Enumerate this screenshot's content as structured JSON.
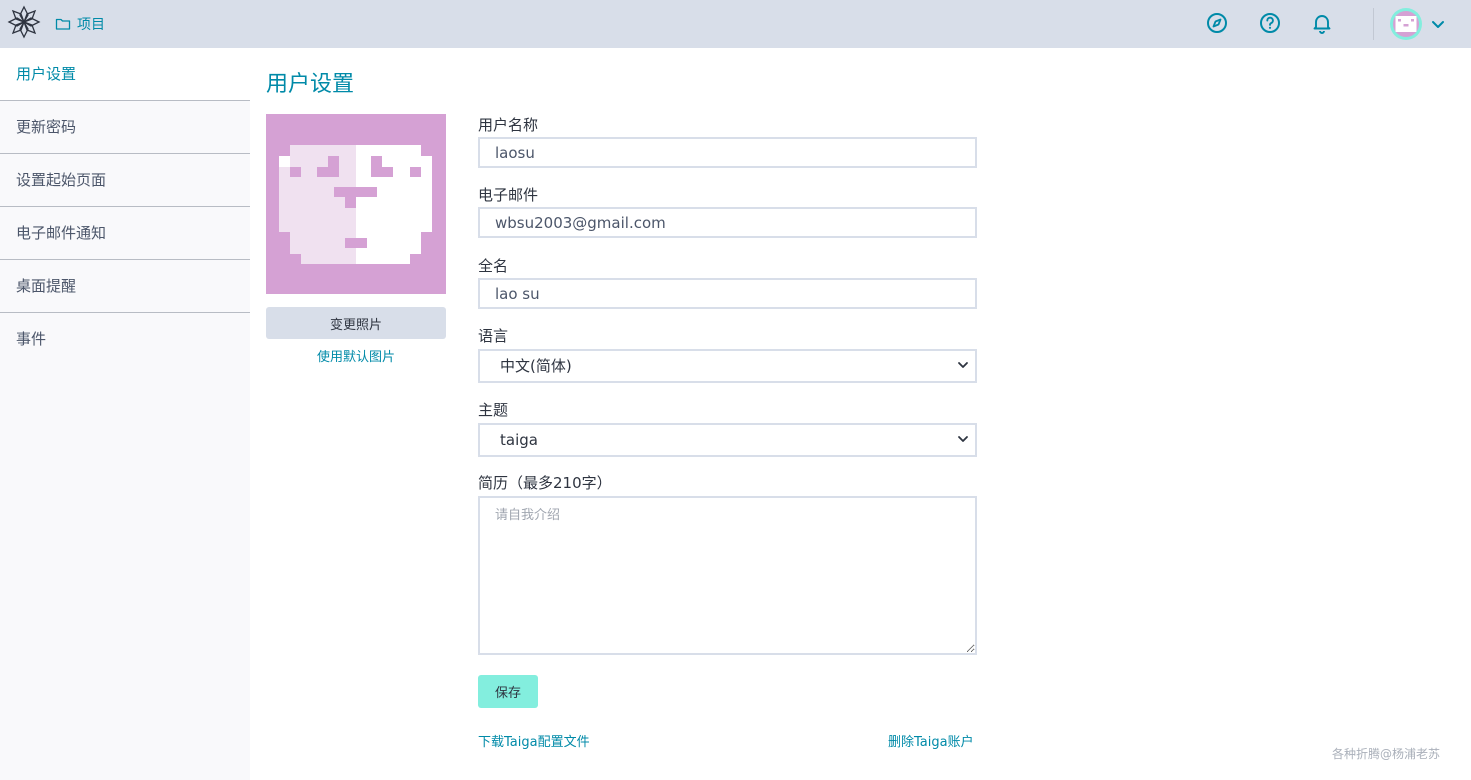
{
  "header": {
    "projects_label": "项目",
    "icons": [
      "logo-icon",
      "folder-icon",
      "compass-icon",
      "help-icon",
      "bell-icon",
      "chevron-down-icon"
    ]
  },
  "sidebar": {
    "items": [
      {
        "label": "用户设置",
        "active": true
      },
      {
        "label": "更新密码"
      },
      {
        "label": "设置起始页面"
      },
      {
        "label": "电子邮件通知"
      },
      {
        "label": "桌面提醒"
      },
      {
        "label": "事件"
      }
    ]
  },
  "page": {
    "title": "用户设置",
    "change_photo": "变更照片",
    "use_default_photo": "使用默认图片"
  },
  "form": {
    "username": {
      "label": "用户名称",
      "value": "laosu"
    },
    "email": {
      "label": "电子邮件",
      "value": "wbsu2003@gmail.com"
    },
    "fullname": {
      "label": "全名",
      "value": "lao su"
    },
    "language": {
      "label": "语言",
      "value": "中文(简体)"
    },
    "theme": {
      "label": "主题",
      "value": "taiga"
    },
    "bio": {
      "label": "简历（最多210字）",
      "placeholder": "请自我介绍"
    },
    "save": "保存"
  },
  "footer": {
    "download": "下载Taiga配置文件",
    "delete": "删除Taiga账户",
    "watermark": "各种折腾@杨浦老苏"
  },
  "colors": {
    "accent": "#008aa8",
    "topbar": "#d8dee9",
    "save_button": "#83eede",
    "avatar_bg": "#d5a1d4"
  }
}
